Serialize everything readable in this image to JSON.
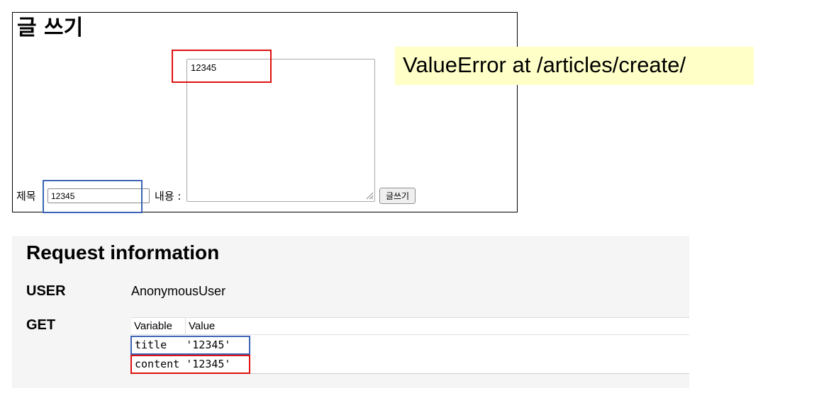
{
  "form": {
    "title": "글 쓰기",
    "title_label": "제목",
    "title_value": "12345",
    "content_label": "내용 :",
    "content_value": "12345",
    "submit_label": "글쓰기"
  },
  "error": {
    "message": "ValueError at /articles/create/"
  },
  "request_info": {
    "heading": "Request information",
    "user_key": "USER",
    "user_value": "AnonymousUser",
    "get_key": "GET",
    "columns": [
      "Variable",
      "Value"
    ],
    "rows": [
      {
        "variable": "title",
        "value": "'12345'"
      },
      {
        "variable": "content",
        "value": "'12345'"
      }
    ]
  },
  "colors": {
    "highlight_blue": "#3c64b4",
    "highlight_red": "#e01010",
    "error_banner_bg": "#ffffc8",
    "panel_bg": "#f5f5f5"
  }
}
